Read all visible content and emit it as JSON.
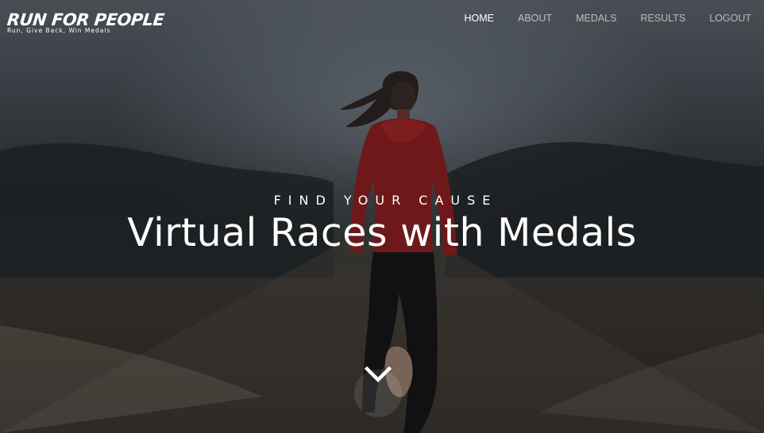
{
  "brand": {
    "title": "RUN FOR PEOPLE",
    "tagline": "Run, Give Back, Win Medals"
  },
  "nav": {
    "items": [
      {
        "label": "HOME",
        "active": true
      },
      {
        "label": "ABOUT",
        "active": false
      },
      {
        "label": "MEDALS",
        "active": false
      },
      {
        "label": "RESULTS",
        "active": false
      },
      {
        "label": "LOGOUT",
        "active": false
      }
    ]
  },
  "hero": {
    "kicker": "Find Your Cause",
    "headline": "Virtual Races with Medals",
    "scroll_icon": "chevron-down-icon"
  },
  "colors": {
    "text": "#ffffff",
    "nav_inactive": "rgba(255,255,255,0.62)",
    "runner_top": "#8e1f22",
    "runner_pants": "#17171a"
  }
}
